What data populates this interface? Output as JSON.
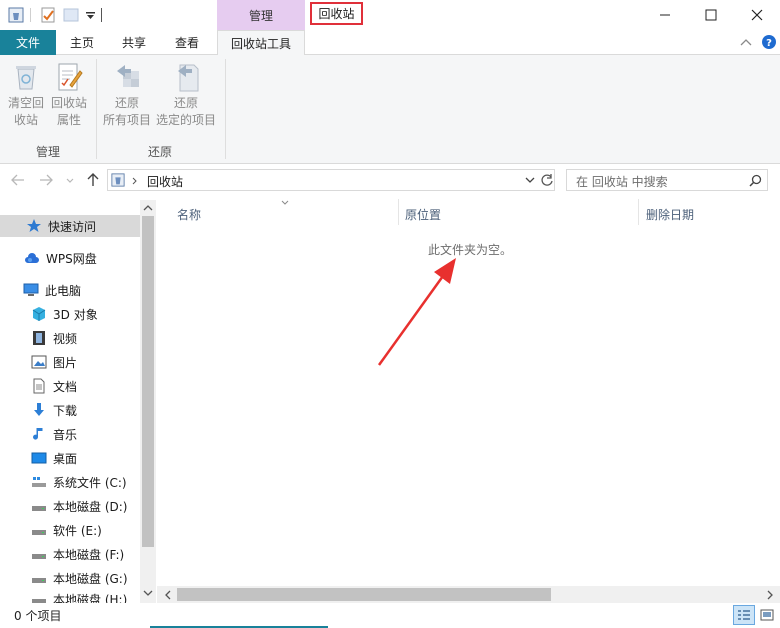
{
  "window": {
    "context_group": "管理",
    "title": "回收站",
    "controls": {
      "minimize_icon": "minimize-icon",
      "maximize_icon": "maximize-icon",
      "close_icon": "close-icon"
    }
  },
  "tabs": {
    "file": "文件",
    "home": "主页",
    "share": "共享",
    "view": "查看",
    "recycle_tools": "回收站工具"
  },
  "ribbon": {
    "empty_bin": {
      "line1": "清空回",
      "line2": "收站"
    },
    "bin_props": {
      "line1": "回收站",
      "line2": "属性"
    },
    "restore_all": {
      "line1": "还原",
      "line2": "所有项目"
    },
    "restore_selected": {
      "line1": "还原",
      "line2": "选定的项目"
    },
    "group_manage": "管理",
    "group_restore": "还原"
  },
  "address": {
    "path": "回收站",
    "search_placeholder": "在 回收站 中搜索"
  },
  "sidebar": {
    "items": [
      {
        "label": "快速访问"
      },
      {
        "label": "WPS网盘"
      },
      {
        "label": "此电脑"
      },
      {
        "label": "3D 对象"
      },
      {
        "label": "视频"
      },
      {
        "label": "图片"
      },
      {
        "label": "文档"
      },
      {
        "label": "下载"
      },
      {
        "label": "音乐"
      },
      {
        "label": "桌面"
      },
      {
        "label": "系统文件 (C:)"
      },
      {
        "label": "本地磁盘 (D:)"
      },
      {
        "label": "软件 (E:)"
      },
      {
        "label": "本地磁盘 (F:)"
      },
      {
        "label": "本地磁盘 (G:)"
      },
      {
        "label": "本地磁盘 (H:)"
      }
    ]
  },
  "columns": {
    "name": "名称",
    "original_location": "原位置",
    "date_deleted": "删除日期"
  },
  "content": {
    "empty_message": "此文件夹为空。"
  },
  "status": {
    "item_count": "0 个项目"
  },
  "colors": {
    "file_tab": "#19829a",
    "context_tab": "#e6ccf0",
    "highlight_box": "#e0303a",
    "annotation_arrow": "#e8302e"
  }
}
